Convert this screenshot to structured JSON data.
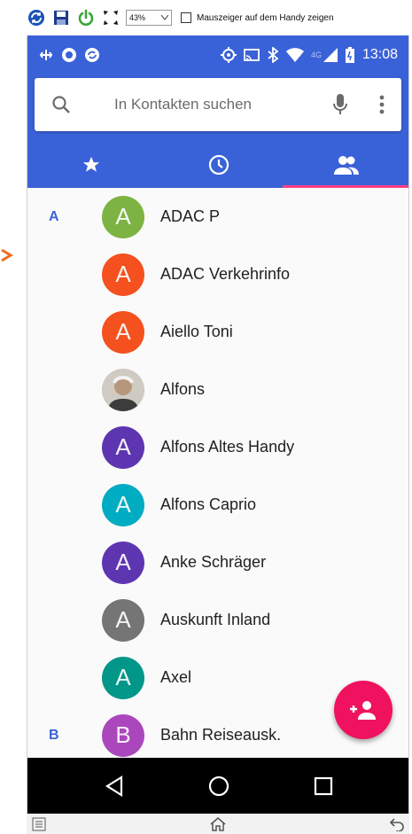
{
  "toolbar": {
    "zoom_value": "43%",
    "pointer_checkbox_label": "Mauszeiger auf dem Handy zeigen"
  },
  "status_bar": {
    "network": "4G",
    "time": "13:08"
  },
  "search": {
    "placeholder": "In Kontakten suchen"
  },
  "tabs": [
    {
      "icon": "star-icon"
    },
    {
      "icon": "clock-icon"
    },
    {
      "icon": "contacts-icon",
      "active": true
    }
  ],
  "contacts": [
    {
      "section": "A",
      "initial": "A",
      "name": "ADAC P",
      "color": "#7cb342"
    },
    {
      "section": "",
      "initial": "A",
      "name": "ADAC Verkehrinfo",
      "color": "#f4511e"
    },
    {
      "section": "",
      "initial": "A",
      "name": "Aiello Toni",
      "color": "#f4511e"
    },
    {
      "section": "",
      "initial": "",
      "name": "Alfons",
      "color": "#d9d5cf",
      "photo": true
    },
    {
      "section": "",
      "initial": "A",
      "name": "Alfons Altes Handy",
      "color": "#5e35b1"
    },
    {
      "section": "",
      "initial": "A",
      "name": "Alfons Caprio",
      "color": "#00acc1"
    },
    {
      "section": "",
      "initial": "A",
      "name": "Anke Schräger",
      "color": "#5e35b1"
    },
    {
      "section": "",
      "initial": "A",
      "name": "Auskunft Inland",
      "color": "#757575"
    },
    {
      "section": "",
      "initial": "A",
      "name": "Axel",
      "color": "#009688"
    },
    {
      "section": "B",
      "initial": "B",
      "name": "Bahn Reiseausk.",
      "color": "#ab47bc"
    }
  ],
  "colors": {
    "primary": "#3a62d8",
    "accent": "#ff4081",
    "fab": "#f0125e"
  }
}
